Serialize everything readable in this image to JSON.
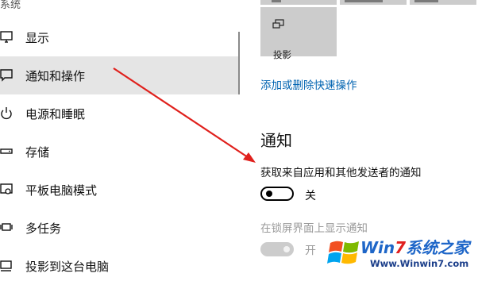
{
  "nav": {
    "header": "系统",
    "items": [
      {
        "label": "显示",
        "icon": "monitor-icon"
      },
      {
        "label": "通知和操作",
        "icon": "message-icon",
        "active": true
      },
      {
        "label": "电源和睡眠",
        "icon": "power-icon"
      },
      {
        "label": "存储",
        "icon": "storage-icon"
      },
      {
        "label": "平板电脑模式",
        "icon": "tablet-icon"
      },
      {
        "label": "多任务",
        "icon": "multitask-icon"
      },
      {
        "label": "投影到这台电脑",
        "icon": "project-icon"
      }
    ]
  },
  "quick_actions": {
    "tile_label": "投影",
    "edit_link": "添加或删除快速操作"
  },
  "notifications": {
    "title": "通知",
    "get_notifications_label": "获取来自应用和其他发送者的通知",
    "get_notifications_state": "关",
    "lock_screen_label": "在锁屏界面上显示通知",
    "lock_screen_state": "开"
  },
  "watermark": {
    "brand_part1": "Win",
    "brand_part2": "7",
    "brand_part3": "系统之家",
    "url": "Www.Winwin7.com"
  },
  "colors": {
    "accent": "#0063b1",
    "annotation_arrow": "#e0201c",
    "tile": "#cccccc",
    "active_nav": "#e5e5e5"
  }
}
